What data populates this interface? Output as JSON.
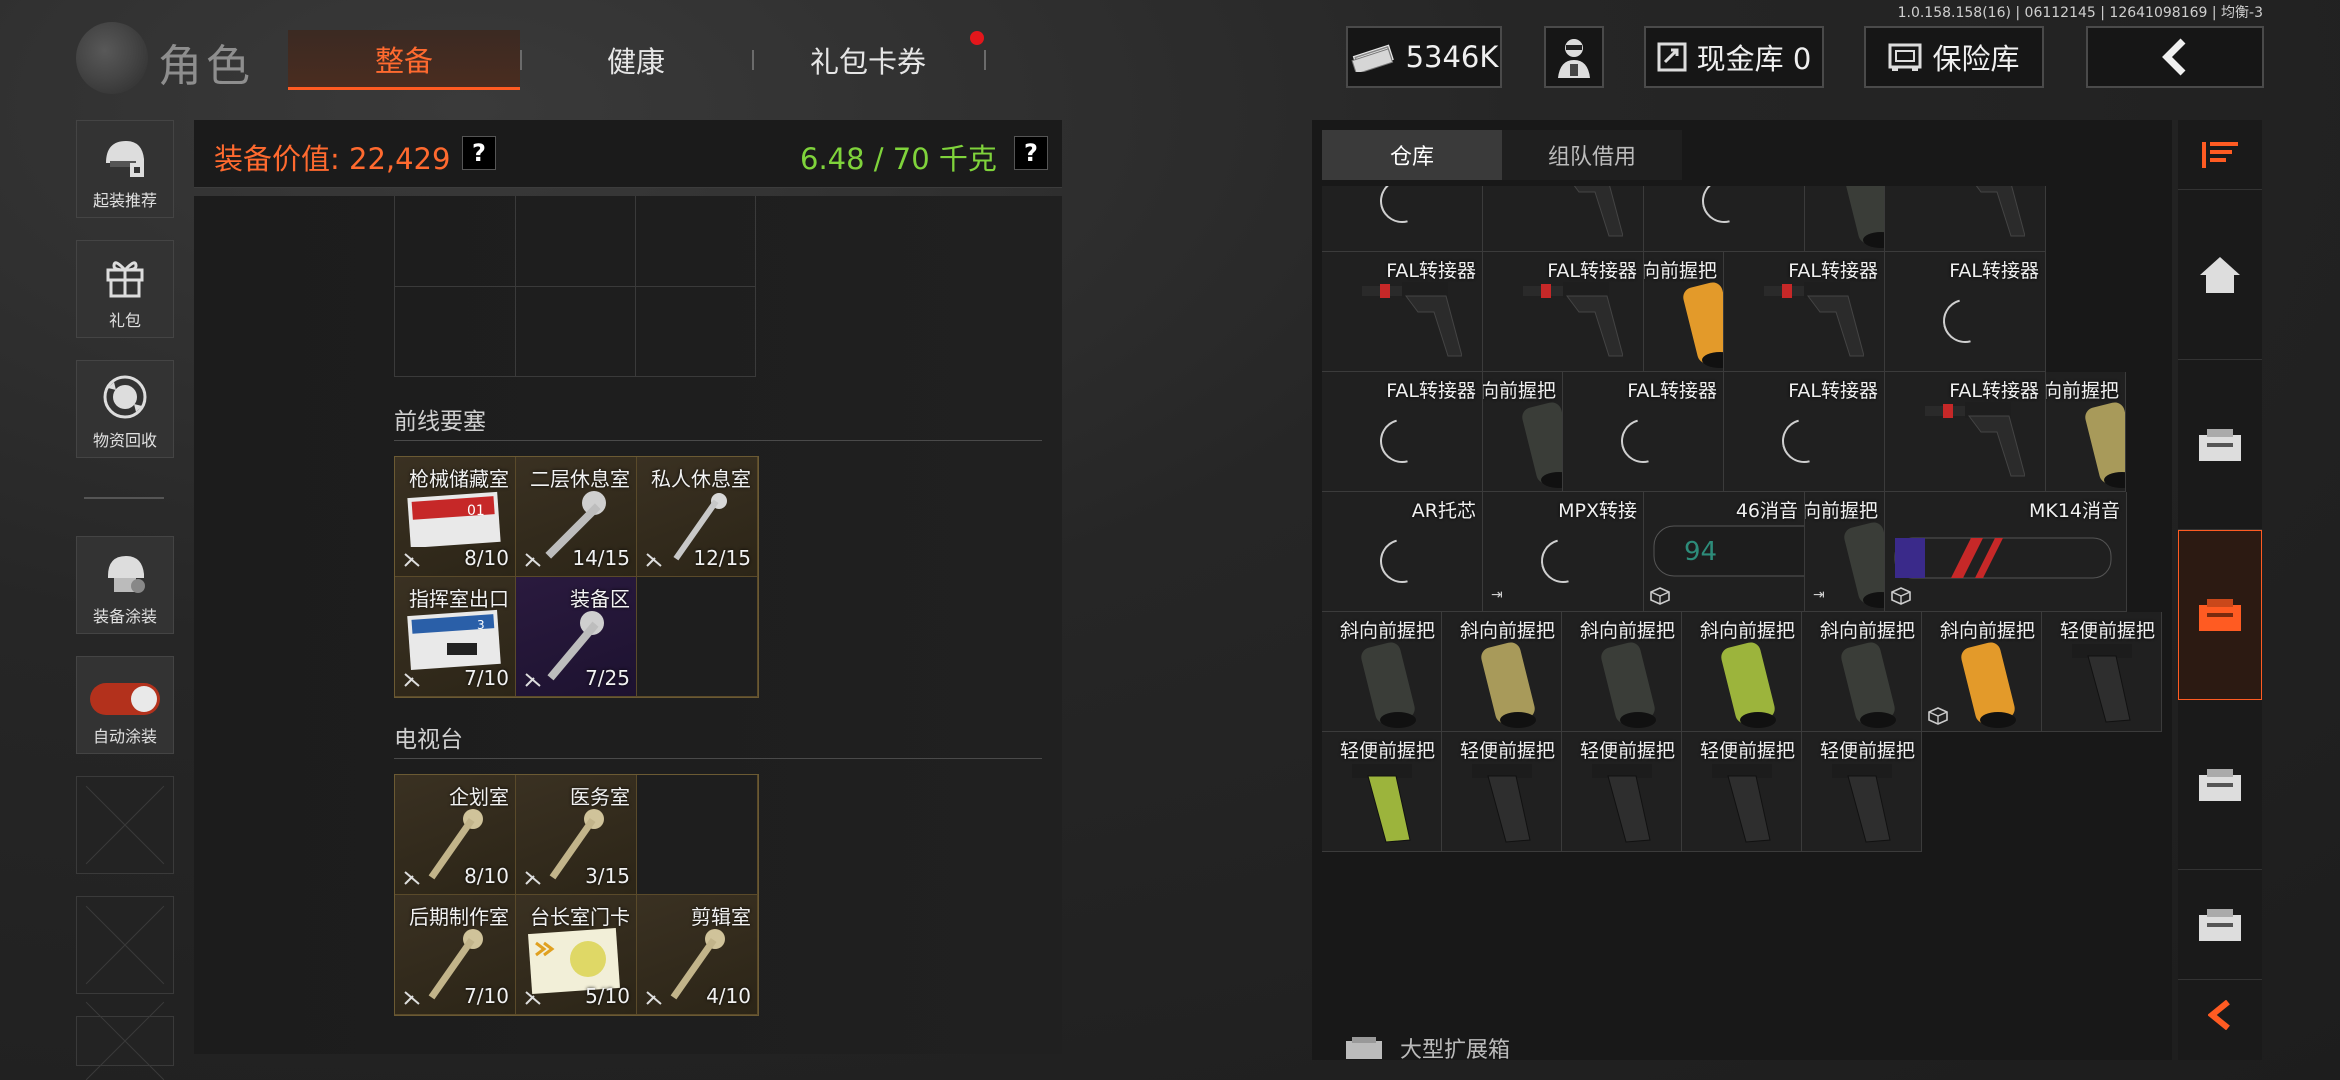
{
  "version_text": "1.0.158.158(16) | 06112145 | 12641098169 | 均衡-3",
  "header": {
    "title": "角色",
    "tabs": [
      {
        "label": "整备",
        "active": true
      },
      {
        "label": "健康",
        "active": false
      },
      {
        "label": "礼包卡券",
        "active": false,
        "badge": "red-dot"
      }
    ],
    "currency_amount": "5346K",
    "cash_vault_label": "现金库 0",
    "safe_label": "保险库",
    "accent": "#ff5b22"
  },
  "sidebar": {
    "items": [
      {
        "label": "起装推荐",
        "icon": "helmet-gear-icon"
      },
      {
        "label": "礼包",
        "icon": "gift-icon"
      },
      {
        "label": "物资回收",
        "icon": "recycle-icon"
      },
      {
        "label": "装备涂装",
        "icon": "paint-helmet-icon"
      },
      {
        "label": "自动涂装",
        "icon": "toggle-on"
      }
    ]
  },
  "loadout": {
    "value_label": "装备价值: 22,429",
    "weight_label": "6.48 / 70 千克",
    "help": "?",
    "sections": [
      {
        "title": "前线要塞",
        "keys": [
          {
            "name": "枪械储藏室",
            "count": "8/10",
            "style": "card"
          },
          {
            "name": "二层休息室",
            "count": "14/15",
            "style": "key"
          },
          {
            "name": "私人休息室",
            "count": "12/15",
            "style": "key"
          },
          {
            "name": "指挥室出口",
            "count": "7/10",
            "style": "card"
          },
          {
            "name": "装备区",
            "count": "7/25",
            "style": "key-purple"
          }
        ]
      },
      {
        "title": "电视台",
        "keys": [
          {
            "name": "企划室",
            "count": "8/10",
            "style": "key"
          },
          {
            "name": "医务室",
            "count": "3/15",
            "style": "key"
          },
          {
            "name": "后期制作室",
            "count": "7/10",
            "style": "key"
          },
          {
            "name": "台长室门卡",
            "count": "5/10",
            "style": "card-yellow"
          },
          {
            "name": "剪辑室",
            "count": "4/10",
            "style": "key"
          }
        ]
      }
    ]
  },
  "inventory": {
    "tabs": [
      {
        "label": "仓库",
        "active": true
      },
      {
        "label": "组队借用",
        "active": false
      }
    ],
    "rows": [
      [
        {
          "name": "FAL转接器",
          "kind": "spinner"
        },
        {
          "name": "FAL转接器",
          "kind": "stock"
        },
        {
          "name": "FAL转接器",
          "kind": "spinner"
        },
        {
          "name": "斜向前握把",
          "kind": "grip-dark"
        }
      ],
      [
        {
          "name": "FAL转接器",
          "kind": "stock"
        },
        {
          "name": "FAL转接器",
          "kind": "stock"
        },
        {
          "name": "FAL转接器",
          "kind": "stock"
        },
        {
          "name": "斜向前握把",
          "kind": "grip-orange"
        }
      ],
      [
        {
          "name": "FAL转接器",
          "kind": "stock"
        },
        {
          "name": "FAL转接器",
          "kind": "spinner"
        },
        {
          "name": "FAL转接器",
          "kind": "spinner"
        },
        {
          "name": "斜向前握把",
          "kind": "grip-dark"
        }
      ],
      [
        {
          "name": "FAL转接器",
          "kind": "spinner"
        },
        {
          "name": "FAL转接器",
          "kind": "spinner"
        },
        {
          "name": "FAL转接器",
          "kind": "stock"
        },
        {
          "name": "斜向前握把",
          "kind": "grip-tan"
        }
      ],
      [
        {
          "name": "AR托芯",
          "kind": "spinner"
        },
        {
          "name": "MPX转接",
          "kind": "spinner",
          "corner": "exit"
        },
        {
          "name": "46消音",
          "kind": "suppressor-46",
          "cube": true
        },
        {
          "name": "斜向前握把",
          "kind": "grip-dark",
          "corner": "exit"
        }
      ],
      [
        {
          "name": "MK14消音",
          "kind": "suppressor-mk14",
          "cube": true
        },
        {
          "name": "斜向前握把",
          "kind": "grip-dark"
        },
        {
          "name": "斜向前握把",
          "kind": "grip-tan"
        },
        {
          "name": "斜向前握把",
          "kind": "grip-dark"
        },
        {
          "name": "斜向前握把",
          "kind": "grip-green"
        },
        {
          "name": "斜向前握把",
          "kind": "grip-dark"
        }
      ],
      [
        {
          "name": "斜向前握把",
          "kind": "grip-orange",
          "cube": true
        },
        {
          "name": "轻便前握把",
          "kind": "light-grip-dark"
        },
        {
          "name": "轻便前握把",
          "kind": "light-grip-green"
        },
        {
          "name": "轻便前握把",
          "kind": "light-grip-dark"
        },
        {
          "name": "轻便前握把",
          "kind": "light-grip-dark"
        },
        {
          "name": "轻便前握把",
          "kind": "light-grip-dark"
        },
        {
          "name": "轻便前握把",
          "kind": "light-grip-dark"
        }
      ]
    ],
    "footer_label": "大型扩展箱",
    "top_row_partial": [
      "FAL转接器",
      "FAL转接器",
      "FAL转接器",
      "斜向前握把"
    ]
  },
  "right_nav": {
    "items": [
      "sort-icon",
      "home-icon",
      "storage-icon",
      "storage-icon-active",
      "storage-icon",
      "storage-icon",
      "collapse-arrow-icon"
    ]
  }
}
